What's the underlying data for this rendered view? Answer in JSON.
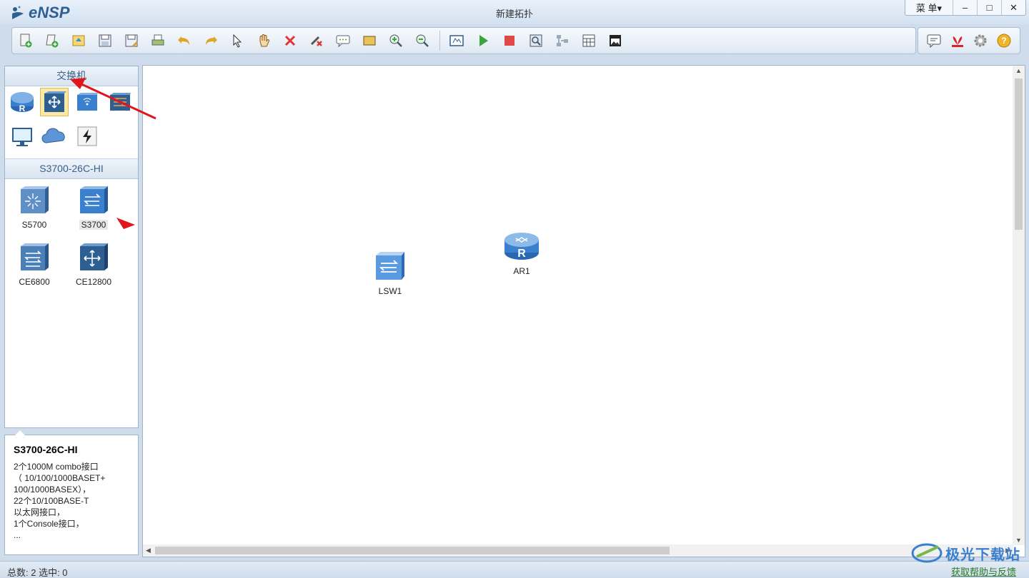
{
  "app": {
    "name": "eNSP",
    "window_title": "新建拓扑"
  },
  "window_controls": {
    "menu_label": "菜 单▾",
    "minimize": "–",
    "maximize": "□",
    "close": "✕"
  },
  "toolbar": {
    "icons": [
      "new-topology-icon",
      "new-exam-icon",
      "open-icon",
      "save-icon",
      "save-as-icon",
      "print-icon",
      "undo-icon",
      "redo-icon",
      "select-icon",
      "pan-hand-icon",
      "delete-icon",
      "delete-link-icon",
      "text-annotation-icon",
      "rectangle-icon",
      "zoom-in-icon",
      "zoom-out-icon",
      "fit-view-icon",
      "start-device-icon",
      "stop-device-icon",
      "capture-icon",
      "topology-icon",
      "grid-icon",
      "screenshot-icon"
    ],
    "right_icons": [
      "chat-icon",
      "huawei-icon",
      "settings-icon",
      "help-icon"
    ]
  },
  "left_panel": {
    "category_header": "交换机",
    "categories": [
      "router",
      "switch",
      "wireless",
      "firewall",
      "pc",
      "cloud",
      "power"
    ],
    "selected_category": "switch",
    "device_header": "S3700-26C-HI",
    "devices": [
      {
        "name": "S5700"
      },
      {
        "name": "S3700"
      },
      {
        "name": "CE6800"
      },
      {
        "name": "CE12800"
      }
    ],
    "selected_device": "S3700"
  },
  "info_panel": {
    "title": "S3700-26C-HI",
    "lines": [
      "2个1000M combo接口",
      "（ 10/100/1000BASET+",
      "100/1000BASEX），",
      "22个10/100BASE-T",
      "以太网接口，",
      "1个Console接口，",
      "..."
    ]
  },
  "canvas": {
    "nodes": [
      {
        "label": "LSW1",
        "type": "switch"
      },
      {
        "label": "AR1",
        "type": "router"
      }
    ]
  },
  "statusbar": {
    "total_label": "总数: 2  选中: 0",
    "help_link": "获取帮助与反馈"
  },
  "watermark": {
    "text": "极光下载站"
  },
  "colors": {
    "accent": "#2e5f93",
    "annotation": "#e0161c",
    "panel_header_text": "#3b5f87"
  }
}
